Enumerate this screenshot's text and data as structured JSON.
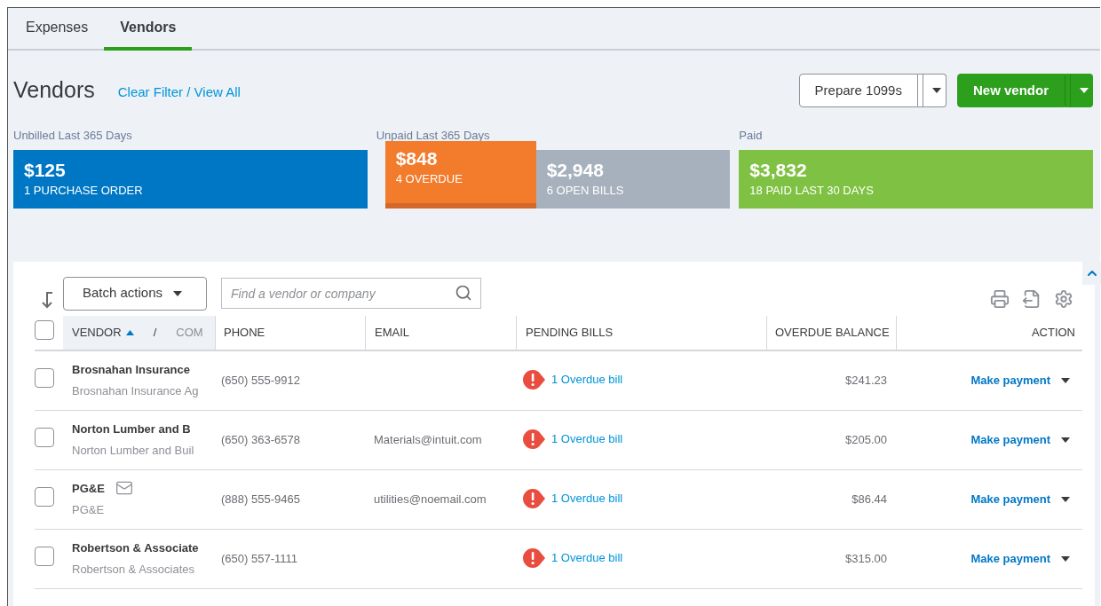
{
  "tabs": [
    {
      "label": "Expenses",
      "selected": false
    },
    {
      "label": "Vendors",
      "selected": true
    }
  ],
  "header": {
    "title": "Vendors",
    "link": "Clear Filter / View All",
    "buttons": [
      {
        "label": "Prepare 1099s",
        "kind": "secondary"
      },
      {
        "label": "New vendor",
        "kind": "primary"
      }
    ]
  },
  "summary": [
    {
      "caption": "Unbilled Last 365 Days",
      "blocks": [
        {
          "amount": "$125",
          "label": "1 PURCHASE ORDER",
          "color": "#0077c5",
          "selected": false
        }
      ]
    },
    {
      "caption": "Unpaid Last 365 Days",
      "blocks": [
        {
          "amount": "$848",
          "label": "4 OVERDUE",
          "color": "#f27b2c",
          "selected": true
        },
        {
          "amount": "$2,948",
          "label": "6 OPEN BILLS",
          "color": "#a7b1bd",
          "selected": false
        }
      ]
    },
    {
      "caption": "Paid",
      "blocks": [
        {
          "amount": "$3,832",
          "label": "18 PAID LAST 30 DAYS",
          "color": "#7fc142",
          "selected": false
        }
      ]
    }
  ],
  "toolbar": {
    "batch": "Batch actions",
    "search_placeholder": "Find a vendor or company"
  },
  "table": {
    "all_checked": false,
    "columns": [
      {
        "label": "VENDOR",
        "sorted": true
      },
      {
        "label": "/",
        "sorted": false
      },
      {
        "label": "COM",
        "sorted": false
      },
      {
        "label": "PHONE",
        "sorted": false
      },
      {
        "label": "EMAIL",
        "sorted": false
      },
      {
        "label": "PENDING BILLS",
        "sorted": false
      },
      {
        "label": "OVERDUE BALANCE",
        "sorted": false
      },
      {
        "label": "ACTION",
        "sorted": false
      }
    ],
    "rows": [
      {
        "checked": false,
        "name": "Brosnahan Insurance",
        "company": "Brosnahan Insurance Ag",
        "mail_icon": false,
        "phone": "(650) 555-9912",
        "email": "",
        "pending": "1 Overdue bill",
        "balance": "$241.23",
        "action": "Make payment"
      },
      {
        "checked": false,
        "name": "Norton Lumber and B",
        "company": "Norton Lumber and Buil",
        "mail_icon": false,
        "phone": "(650) 363-6578",
        "email": "Materials@intuit.com",
        "pending": "1 Overdue bill",
        "balance": "$205.00",
        "action": "Make payment"
      },
      {
        "checked": false,
        "name": "PG&E",
        "company": "PG&E",
        "mail_icon": true,
        "phone": "(888) 555-9465",
        "email": "utilities@noemail.com",
        "pending": "1 Overdue bill",
        "balance": "$86.44",
        "action": "Make payment"
      },
      {
        "checked": false,
        "name": "Robertson & Associate",
        "company": "Robertson & Associates",
        "mail_icon": false,
        "phone": "(650) 557-1111",
        "email": "",
        "pending": "1 Overdue bill",
        "balance": "$315.00",
        "action": "Make payment"
      }
    ]
  }
}
